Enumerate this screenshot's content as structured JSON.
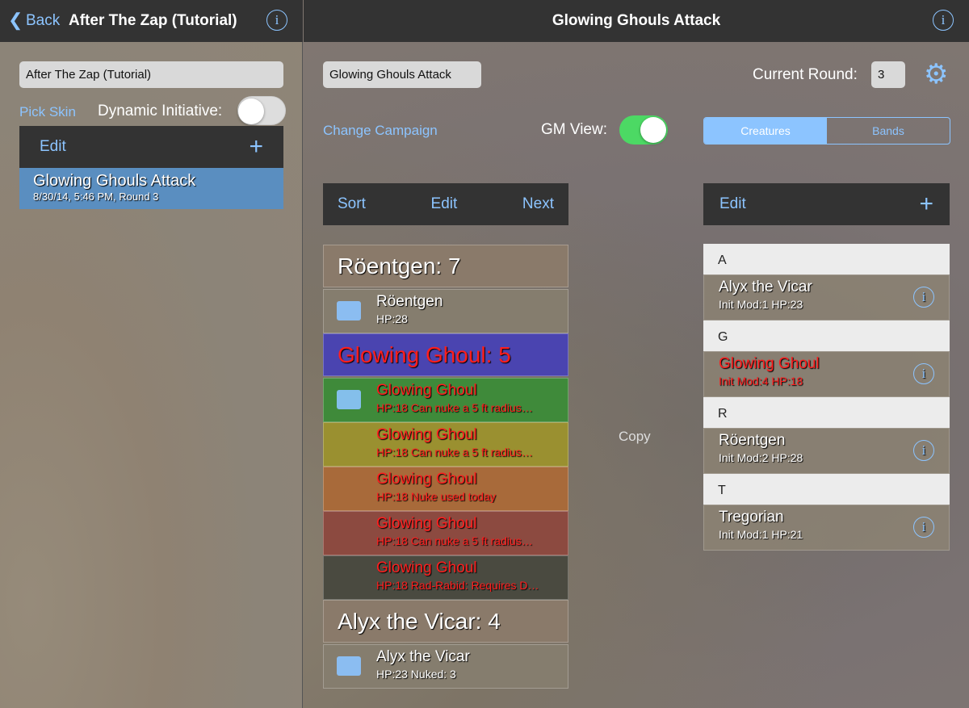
{
  "left": {
    "back": "Back",
    "title": "After The Zap (Tutorial)",
    "campaign_name": "After The Zap (Tutorial)",
    "pick_skin": "Pick Skin",
    "dynamic_initiative": "Dynamic Initiative:",
    "dynamic_on": false,
    "edit": "Edit",
    "encounters": [
      {
        "name": "Glowing Ghouls Attack",
        "detail": "8/30/14, 5:46 PM, Round 3"
      }
    ]
  },
  "main": {
    "title": "Glowing Ghouls Attack",
    "encounter_name": "Glowing Ghouls Attack",
    "current_round_label": "Current Round:",
    "current_round": "3",
    "change_campaign": "Change Campaign",
    "gm_view": "GM View:",
    "gm_on": true,
    "segments": [
      "Creatures",
      "Bands"
    ],
    "selected_segment": "Creatures",
    "copy": "Copy",
    "init_toolbar": {
      "sort": "Sort",
      "edit": "Edit",
      "next": "Next"
    },
    "initiative": [
      {
        "header": "Röentgen: 7",
        "red": false,
        "bg": "#8a7a6a",
        "items": [
          {
            "name": "Röentgen",
            "detail": "HP:28",
            "bg": "#857d6e",
            "icon": "stat-card-icon"
          }
        ]
      },
      {
        "header": "Glowing Ghoul: 5",
        "red": true,
        "bg": "#4a44b0",
        "items": [
          {
            "name": "Glowing Ghoul",
            "detail": "HP:18 Can nuke a 5 ft radius…",
            "bg": "#3f8a3a",
            "icon": "eye-icon"
          },
          {
            "name": "Glowing Ghoul",
            "detail": "HP:18 Can nuke a 5 ft radius…",
            "bg": "#9a9030"
          },
          {
            "name": "Glowing Ghoul",
            "detail": "HP:18 Nuke used today",
            "bg": "#a86a3a"
          },
          {
            "name": "Glowing Ghoul",
            "detail": "HP:18 Can nuke a 5 ft radius…",
            "bg": "#8c4a40"
          },
          {
            "name": "Glowing Ghoul",
            "detail": "HP:18 Rad-Rabid: Requires D…",
            "bg": "#4a4a40"
          }
        ]
      },
      {
        "header": "Alyx the Vicar: 4",
        "red": false,
        "bg": "#8a7a6a",
        "items": [
          {
            "name": "Alyx the Vicar",
            "detail": "HP:23 Nuked: 3",
            "bg": "#857d6e",
            "icon": "stat-card-icon"
          }
        ]
      }
    ]
  },
  "creatures": {
    "edit": "Edit",
    "sections": [
      {
        "letter": "A",
        "items": [
          {
            "name": "Alyx the Vicar",
            "detail": "Init Mod:1 HP:23",
            "red": false
          }
        ]
      },
      {
        "letter": "G",
        "items": [
          {
            "name": "Glowing Ghoul",
            "detail": "Init Mod:4 HP:18",
            "red": true
          }
        ]
      },
      {
        "letter": "R",
        "items": [
          {
            "name": "Röentgen",
            "detail": "Init Mod:2 HP:28",
            "red": false
          }
        ]
      },
      {
        "letter": "T",
        "items": [
          {
            "name": "Tregorian",
            "detail": "Init Mod:1 HP:21",
            "red": false
          }
        ]
      }
    ]
  },
  "colors": {
    "accent": "#8cc4ff",
    "toggle_on": "#4cd964",
    "enemy_text": "#ff1e1e"
  }
}
